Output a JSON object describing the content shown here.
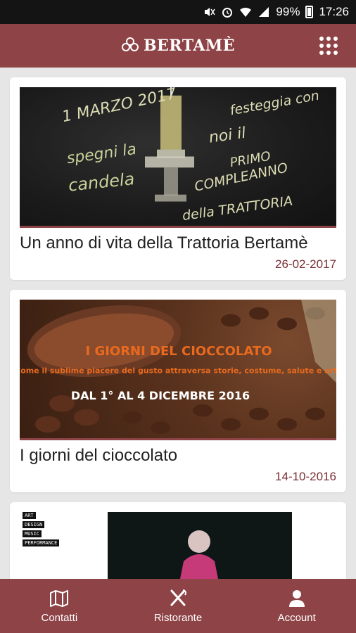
{
  "status_bar": {
    "battery_pct": "99%",
    "time": "17:26"
  },
  "app_bar": {
    "logo_text": "BERTAMÈ"
  },
  "feed": {
    "items": [
      {
        "title": "Un anno di vita della Trattoria Bertamè",
        "date": "26-02-2017",
        "image_text": {
          "line1": "1 MARZO 2017",
          "line2": "spegni la",
          "line3": "candela",
          "line4": "festeggia con",
          "line5": "noi il",
          "line6": "PRIMO",
          "line7": "COMPLEANNO",
          "line8": "della TRATTORIA"
        }
      },
      {
        "title": "I giorni del cioccolato",
        "date": "14-10-2016",
        "image_text": {
          "headline": "I GIORNI DEL CIOCCOLATO",
          "subline": "Come il sublime piacere del gusto attraversa storie, costume, salute e arte",
          "dates": "DAL 1° AL 4 DICEMBRE 2016"
        }
      },
      {
        "tags": [
          "ART",
          "DESIGN",
          "MUSIC",
          "PERFORMANCE"
        ]
      }
    ]
  },
  "bottom_nav": {
    "items": [
      {
        "label": "Contatti",
        "icon": "map-icon"
      },
      {
        "label": "Ristorante",
        "icon": "fork-knife-icon"
      },
      {
        "label": "Account",
        "icon": "user-icon"
      }
    ]
  },
  "colors": {
    "brand": "#8e4346",
    "date_text": "#7a2f33",
    "status_bar": "#141414",
    "background": "#e6e6e6"
  }
}
